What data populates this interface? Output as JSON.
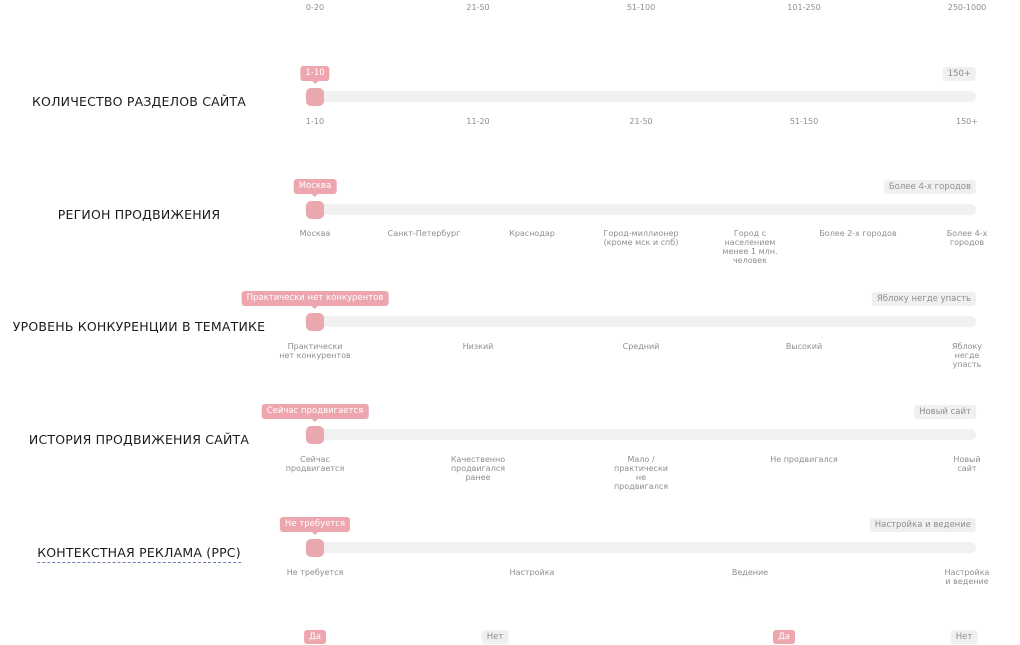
{
  "top_scale": [
    "0-20",
    "21-50",
    "51-100",
    "101-250",
    "250-1000"
  ],
  "sliders": [
    {
      "label": "КОЛИЧЕСТВО РАЗДЕЛОВ САЙТА",
      "value": "1-10",
      "max_label": "150+",
      "ticks": [
        "1-10",
        "11-20",
        "21-50",
        "51-150",
        "150+"
      ]
    },
    {
      "label": "РЕГИОН ПРОДВИЖЕНИЯ",
      "value": "Москва",
      "max_label": "Более 4-х городов",
      "ticks": [
        "Москва",
        "Санкт-Петербург",
        "Краснодар",
        "Город-миллионер (кроме мск и спб)",
        "Город с населением менее 1 млн. человек",
        "Более 2-х городов",
        "Более 4-х городов"
      ]
    },
    {
      "label": "УРОВЕНЬ КОНКУРЕНЦИИ В ТЕМАТИКЕ",
      "value": "Практически нет конкурентов",
      "max_label": "Яблоку негде упасть",
      "ticks": [
        "Практически нет конкурентов",
        "Низкий",
        "Средний",
        "Высокий",
        "Яблоку негде упасть"
      ]
    },
    {
      "label": "ИСТОРИЯ ПРОДВИЖЕНИЯ САЙТА",
      "value": "Сейчас продвигается",
      "max_label": "Новый сайт",
      "ticks": [
        "Сейчас продвигается",
        "Качественно продвигался ранее",
        "Мало / практически не продвигался",
        "Не продвигался",
        "Новый сайт"
      ]
    },
    {
      "label": "КОНТЕКСТНАЯ РЕКЛАМА (PPC)",
      "value": "Не требуется",
      "max_label": "Настройка и ведение",
      "ticks": [
        "Не требуется",
        "Настройка",
        "Ведение",
        "Настройка и ведение"
      ]
    }
  ],
  "toggles": [
    {
      "label": "Да",
      "active": true
    },
    {
      "label": "Нет",
      "active": false
    },
    {
      "label": "Да",
      "active": true
    },
    {
      "label": "Нет",
      "active": false
    }
  ],
  "colors": {
    "accent": "#eda6ae",
    "knob": "#e8a8ae",
    "track": "#f1f1f2",
    "muted_text": "#8e8e8e",
    "chip_bg": "#f0f0f0",
    "link_underline": "#6b7fae"
  }
}
